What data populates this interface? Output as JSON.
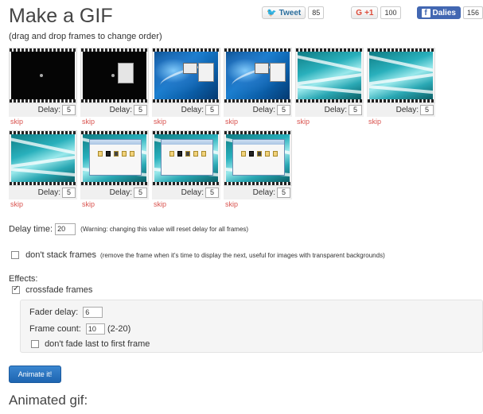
{
  "page": {
    "title": "Make a GIF",
    "subtitle": "(drag and drop frames to change order)"
  },
  "social": {
    "tweet": {
      "label": "Tweet",
      "count": "85"
    },
    "gplus": {
      "label": "+1",
      "count": "100"
    },
    "facebook": {
      "label": "Dalies",
      "count": "156"
    }
  },
  "frames": {
    "delay_label": "Delay:",
    "skip_label": "skip",
    "items": [
      {
        "kind": "dark",
        "delay": "5"
      },
      {
        "kind": "dark-menu",
        "delay": "5"
      },
      {
        "kind": "blue",
        "delay": "5"
      },
      {
        "kind": "blue",
        "delay": "5"
      },
      {
        "kind": "teal",
        "delay": "5"
      },
      {
        "kind": "teal",
        "delay": "5"
      },
      {
        "kind": "teal",
        "delay": "5"
      },
      {
        "kind": "teal-explorer",
        "delay": "5"
      },
      {
        "kind": "teal-explorer",
        "delay": "5"
      },
      {
        "kind": "teal-explorer",
        "delay": "5"
      }
    ]
  },
  "settings": {
    "delay_time_label": "Delay time:",
    "delay_time_value": "20",
    "delay_time_warning": "(Warning: changing this value will reset delay for all frames)",
    "dont_stack_label": "don't stack frames",
    "dont_stack_hint": "(remove the frame when it's time to display the next, useful for images with transparent backgrounds)",
    "effects_label": "Effects:",
    "crossfade_label": "crossfade frames",
    "fader_delay_label": "Fader delay:",
    "fader_delay_value": "6",
    "frame_count_label": "Frame count:",
    "frame_count_value": "10",
    "frame_count_range": "(2-20)",
    "dont_fade_label": "don't fade last to first frame"
  },
  "actions": {
    "animate_label": "Animate it!"
  },
  "result": {
    "title": "Animated gif:"
  }
}
